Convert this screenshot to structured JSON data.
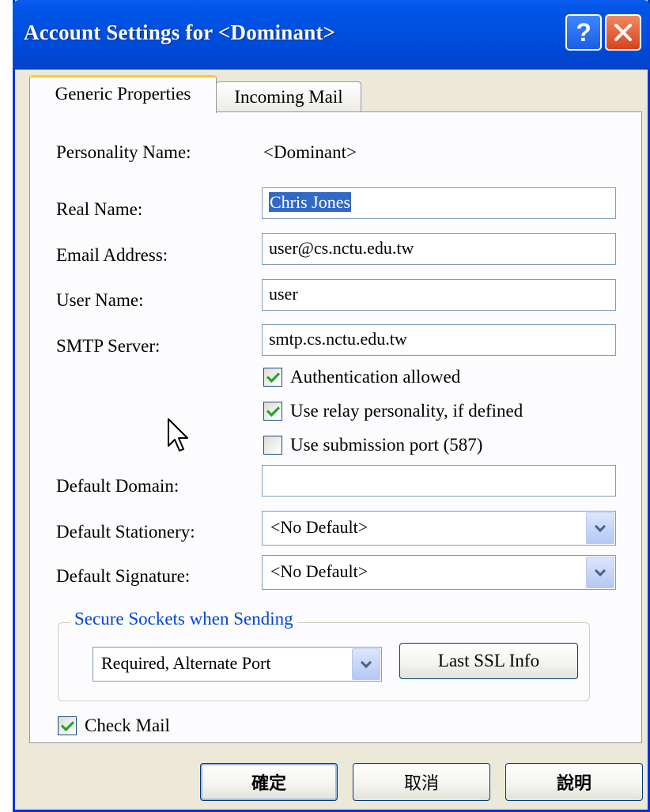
{
  "window": {
    "title": "Account Settings for <Dominant>",
    "help_glyph": "?",
    "close_glyph": "✕"
  },
  "tabs": [
    {
      "label": "Generic Properties",
      "active": true
    },
    {
      "label": "Incoming Mail",
      "active": false
    }
  ],
  "fields": {
    "personality_label": "Personality Name:",
    "personality_value": "<Dominant>",
    "real_name_label": "Real Name:",
    "real_name_value": "Chris Jones",
    "email_label": "Email Address:",
    "email_value": "user@cs.nctu.edu.tw",
    "user_name_label": "User Name:",
    "user_name_value": "user",
    "smtp_label": "SMTP Server:",
    "smtp_value": "smtp.cs.nctu.edu.tw",
    "default_domain_label": "Default Domain:",
    "default_domain_value": "",
    "default_stationery_label": "Default Stationery:",
    "default_stationery_value": "<No Default>",
    "default_signature_label": "Default Signature:",
    "default_signature_value": "<No Default>"
  },
  "checkboxes": {
    "authentication": {
      "label": "Authentication allowed",
      "checked": true
    },
    "relay": {
      "label": "Use relay personality, if defined",
      "checked": true
    },
    "submission": {
      "label": "Use submission port (587)",
      "checked": false
    },
    "check_mail": {
      "label": "Check Mail",
      "checked": true
    }
  },
  "ssl": {
    "group_title": "Secure Sockets when Sending",
    "selected": "Required, Alternate Port",
    "last_info_button": "Last SSL Info"
  },
  "buttons": {
    "ok": "確定",
    "cancel": "取消",
    "help": "說明"
  },
  "colors": {
    "titlebar": "#0050e0",
    "accent_group_title": "#0046d5",
    "check_green": "#21a121",
    "selection": "#316ac5"
  }
}
